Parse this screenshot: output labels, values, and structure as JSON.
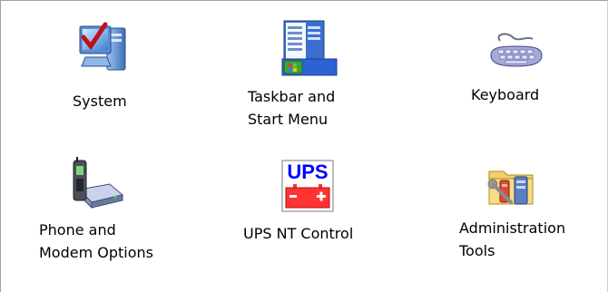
{
  "window": {
    "background": "#ffffff"
  },
  "applets": [
    {
      "label": "System",
      "icon": "system-monitor-check-icon"
    },
    {
      "label": "Taskbar and\nStart Menu",
      "icon": "taskbar-start-menu-icon"
    },
    {
      "label": "Keyboard",
      "icon": "keyboard-icon"
    },
    {
      "label": "Phone and\nModem Options",
      "icon": "phone-modem-icon"
    },
    {
      "label": "UPS NT Control",
      "icon": "ups-battery-icon",
      "icon_text": "UPS"
    },
    {
      "label": "Administration\nTools",
      "icon": "admin-tools-folder-icon"
    }
  ],
  "colors": {
    "ups_text": "#0000ff",
    "ups_battery": "#ff3333",
    "check_red": "#c0101a"
  }
}
